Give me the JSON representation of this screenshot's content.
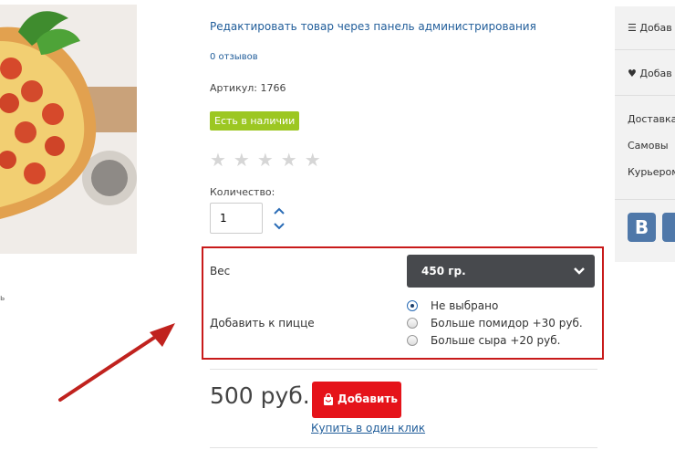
{
  "product": {
    "admin_link": "Редактировать товар через панель администрирования",
    "reviews": "0 отзывов",
    "sku": "Артикул: 1766",
    "availability": "Есть в наличии",
    "rating_stars": "★★★★★",
    "rating": 0,
    "quantity_label": "Количество:",
    "quantity_value": "1"
  },
  "options": {
    "weight_label": "Вес",
    "weight_value": "450 гр.",
    "addon_label": "Добавить к пицце",
    "addons": [
      {
        "label": "Не выбрано",
        "checked": true
      },
      {
        "label": "Больше помидор +30 руб.",
        "checked": false
      },
      {
        "label": "Больше сыра +20 руб.",
        "checked": false
      }
    ]
  },
  "purchase": {
    "price": "500 руб.",
    "add_button": "Добавить",
    "one_click": "Купить в один клик"
  },
  "sidebar": {
    "compare": "Добав",
    "wishlist": "Добав",
    "delivery_title": "Доставка",
    "pickup": "Самовы",
    "courier": "Курьером",
    "vk_letter": "В"
  },
  "left_stray": "ь",
  "colors": {
    "accent_red": "#e5131a",
    "highlight_border": "#c81a1a",
    "stock_green": "#9cc722",
    "link_blue": "#1f5c99",
    "select_dark": "#47494d"
  },
  "icons": [
    "bars-icon",
    "heart-icon",
    "bag-icon",
    "chevron-down-icon",
    "chevron-up-icon",
    "vk-icon",
    "star-icon",
    "arrow-annotation"
  ]
}
